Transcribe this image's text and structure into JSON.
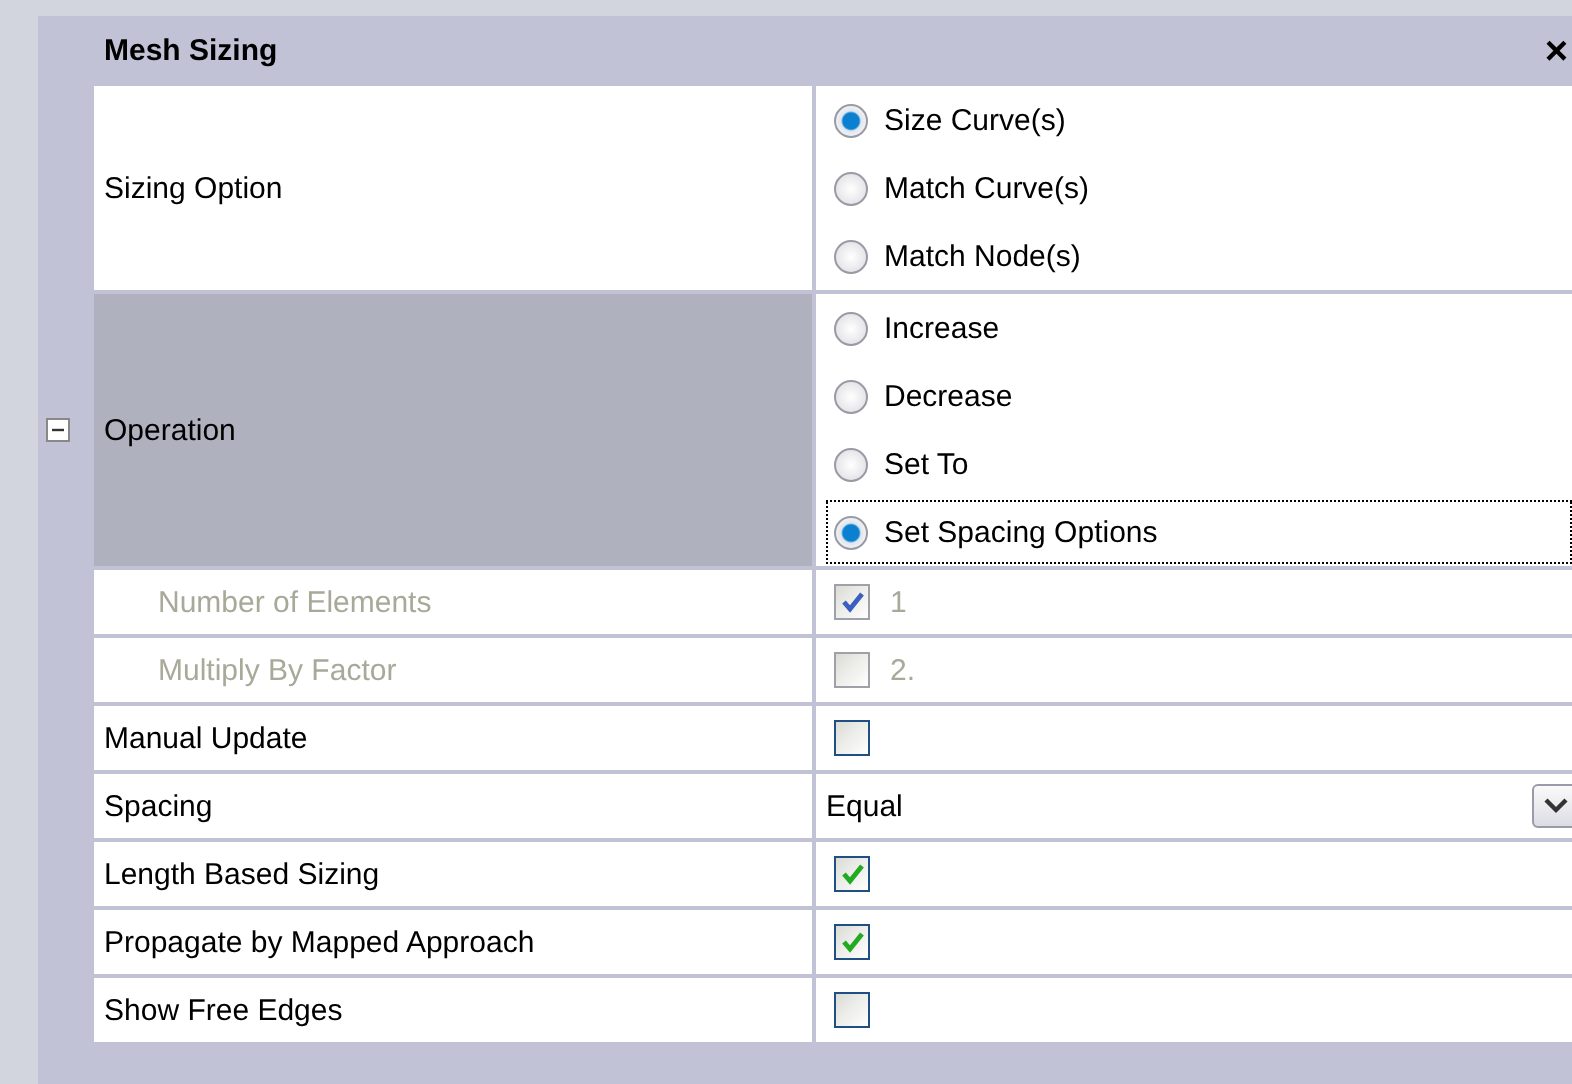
{
  "panel": {
    "title": "Mesh Sizing",
    "close": "×"
  },
  "rows": [
    {
      "kind": "radio",
      "label": "Sizing Option",
      "selected": false,
      "disabled": false,
      "options": [
        {
          "label": "Size Curve(s)",
          "selected": true,
          "focused": false
        },
        {
          "label": "Match Curve(s)",
          "selected": false,
          "focused": false
        },
        {
          "label": "Match Node(s)",
          "selected": false,
          "focused": false
        }
      ]
    },
    {
      "kind": "radio",
      "label": "Operation",
      "selected": true,
      "disabled": false,
      "expanded": true,
      "options": [
        {
          "label": "Increase",
          "selected": false,
          "focused": false
        },
        {
          "label": "Decrease",
          "selected": false,
          "focused": false
        },
        {
          "label": "Set To",
          "selected": false,
          "focused": false
        },
        {
          "label": "Set Spacing Options",
          "selected": true,
          "focused": true
        }
      ]
    },
    {
      "kind": "check",
      "label": "Number of Elements",
      "selected": false,
      "disabled": true,
      "indented": true,
      "checked": true,
      "value": "1"
    },
    {
      "kind": "check",
      "label": "Multiply By Factor",
      "selected": false,
      "disabled": true,
      "indented": true,
      "checked": false,
      "value": "2."
    },
    {
      "kind": "check",
      "label": "Manual Update",
      "selected": false,
      "disabled": false,
      "checked": false
    },
    {
      "kind": "select",
      "label": "Spacing",
      "selected": false,
      "disabled": false,
      "value": "Equal"
    },
    {
      "kind": "check",
      "label": "Length Based Sizing",
      "selected": false,
      "disabled": false,
      "checked": true
    },
    {
      "kind": "check",
      "label": "Propagate by Mapped Approach",
      "selected": false,
      "disabled": false,
      "checked": true
    },
    {
      "kind": "check",
      "label": "Show Free Edges",
      "selected": false,
      "disabled": false,
      "checked": false
    }
  ]
}
